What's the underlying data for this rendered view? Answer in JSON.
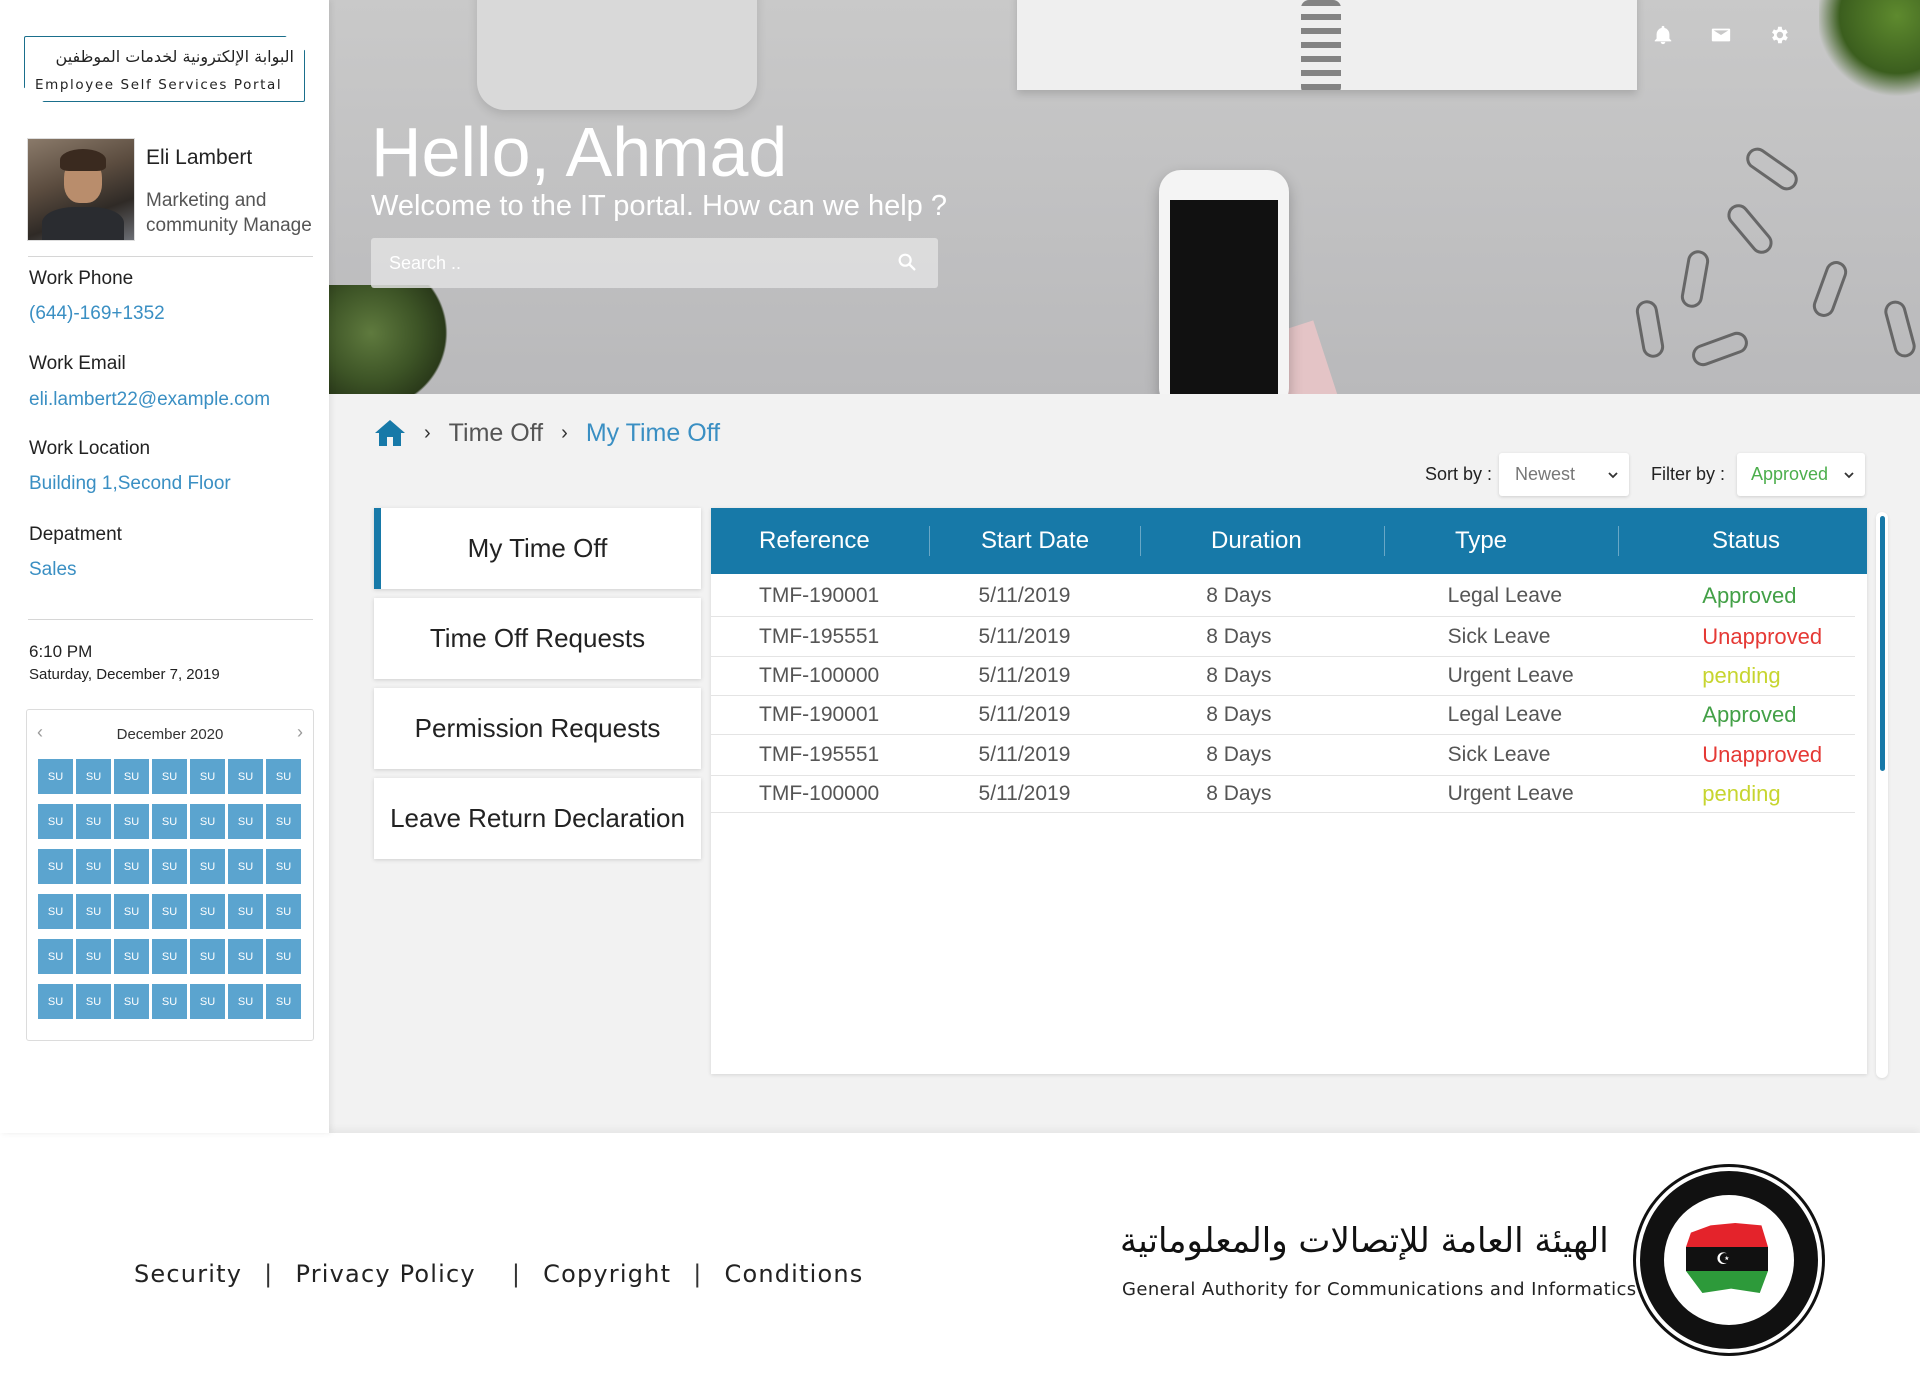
{
  "colors": {
    "primary": "#1779a8",
    "link": "#3a8fc3",
    "approved": "#43a047",
    "unapproved": "#e53935",
    "pending": "#c7d530",
    "calendar_cell": "#5ba4cf"
  },
  "logo": {
    "arabic": "البوابة الإلكترونية لخدمات الموظفين",
    "english": "Employee Self Services Portal"
  },
  "profile": {
    "name": "Eli Lambert",
    "role": "Marketing and community Manage"
  },
  "contact": {
    "work_phone_label": "Work Phone",
    "work_phone": "(644)-169+1352",
    "work_email_label": "Work Email",
    "work_email": "eli.lambert22@example.com",
    "work_location_label": "Work Location",
    "work_location": "Building 1,Second Floor",
    "department_label": "Depatment",
    "department": "Sales"
  },
  "clock": {
    "time": "6:10 PM",
    "date": "Saturday, December 7, 2019"
  },
  "calendar": {
    "month": "December 2020",
    "prev_icon": "chevron-left-icon",
    "next_icon": "chevron-right-icon",
    "cell_label": "SU",
    "rows": 6,
    "cols": 7
  },
  "hero": {
    "title": "Hello, Ahmad",
    "subtitle": "Welcome to the IT portal. How can we help ?",
    "search_placeholder": "Search ..",
    "icons": [
      "bell-icon",
      "mail-icon",
      "gear-icon"
    ]
  },
  "breadcrumb": {
    "home_icon": "home-icon",
    "items": [
      "Time Off",
      "My Time Off"
    ]
  },
  "controls": {
    "sort_label": "Sort by :",
    "sort_value": "Newest",
    "filter_label": "Filter by :",
    "filter_value": "Approved"
  },
  "tabs": [
    {
      "label": "My Time Off",
      "active": true
    },
    {
      "label": "Time Off Requests",
      "active": false
    },
    {
      "label": "Permission Requests",
      "active": false
    },
    {
      "label": "Leave Return Declaration",
      "active": false
    }
  ],
  "table": {
    "columns": [
      "Reference",
      "Start Date",
      "Duration",
      "Type",
      "Status"
    ],
    "rows": [
      {
        "reference": "TMF-190001",
        "start_date": "5/11/2019",
        "duration": "8 Days",
        "type": "Legal Leave",
        "status": "Approved"
      },
      {
        "reference": "TMF-195551",
        "start_date": "5/11/2019",
        "duration": "8 Days",
        "type": "Sick Leave",
        "status": "Unapproved"
      },
      {
        "reference": "TMF-100000",
        "start_date": "5/11/2019",
        "duration": "8 Days",
        "type": "Urgent Leave",
        "status": "pending"
      },
      {
        "reference": "TMF-190001",
        "start_date": "5/11/2019",
        "duration": "8 Days",
        "type": "Legal Leave",
        "status": "Approved"
      },
      {
        "reference": "TMF-195551",
        "start_date": "5/11/2019",
        "duration": "8 Days",
        "type": "Sick Leave",
        "status": "Unapproved"
      },
      {
        "reference": "TMF-100000",
        "start_date": "5/11/2019",
        "duration": "8 Days",
        "type": "Urgent Leave",
        "status": "pending"
      }
    ]
  },
  "footer": {
    "links": [
      "Security",
      "Privacy Policy",
      "Copyright",
      "Conditions"
    ],
    "org_arabic": "الهيئة العامة للإتصالات والمعلوماتية",
    "org_english": "General Authority for Communications and Informatics",
    "seal_icon": "authority-seal-icon"
  }
}
